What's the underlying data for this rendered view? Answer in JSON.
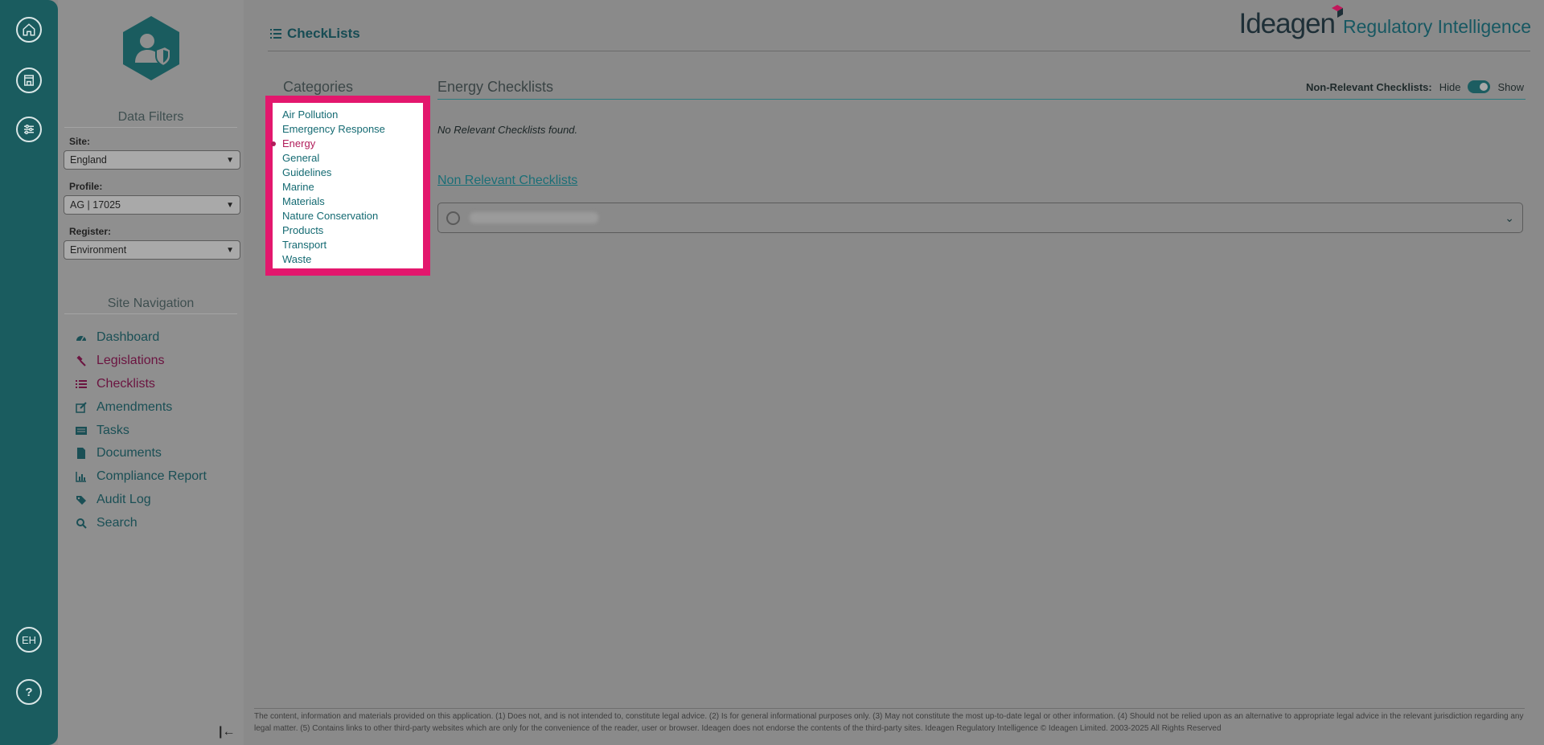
{
  "rail": {
    "items": [
      {
        "icon": "home-icon"
      },
      {
        "icon": "building-icon"
      },
      {
        "icon": "sliders-icon"
      }
    ],
    "user_initials": "EH",
    "help_label": "?"
  },
  "sidebar": {
    "data_filters_title": "Data Filters",
    "site_label": "Site:",
    "site_value": "England",
    "profile_label": "Profile:",
    "profile_value": "AG | 17025",
    "register_label": "Register:",
    "register_value": "Environment",
    "site_nav_title": "Site Navigation",
    "nav": [
      {
        "label": "Dashboard",
        "icon": "dashboard-icon"
      },
      {
        "label": "Legislations",
        "icon": "gavel-icon"
      },
      {
        "label": "Checklists",
        "icon": "list-icon",
        "active": true
      },
      {
        "label": "Amendments",
        "icon": "edit-icon"
      },
      {
        "label": "Tasks",
        "icon": "tasks-icon"
      },
      {
        "label": "Documents",
        "icon": "document-icon"
      },
      {
        "label": "Compliance Report",
        "icon": "bar-chart-icon"
      },
      {
        "label": "Audit Log",
        "icon": "tags-icon"
      },
      {
        "label": "Search",
        "icon": "search-icon"
      }
    ]
  },
  "header": {
    "title": "CheckLists",
    "brand_name": "Ideagen",
    "brand_product": "Regulatory Intelligence"
  },
  "categories": {
    "title": "Categories",
    "items": [
      "Air Pollution",
      "Emergency Response",
      "Energy",
      "General",
      "Guidelines",
      "Marine",
      "Materials",
      "Nature Conservation",
      "Products",
      "Transport",
      "Waste"
    ],
    "selected": "Energy"
  },
  "content": {
    "title": "Energy Checklists",
    "non_relevant_label": "Non-Relevant Checklists:",
    "hide_label": "Hide",
    "show_label": "Show",
    "no_found": "No Relevant Checklists found.",
    "non_relevant_link": "Non Relevant Checklists"
  },
  "footer": {
    "text": "The content, information and materials provided on this application. (1) Does not, and is not intended to, constitute legal advice. (2) Is for general informational purposes only. (3) May not constitute the most up-to-date legal or other information. (4) Should not be relied upon as an alternative to appropriate legal advice in the relevant jurisdiction regarding any legal matter. (5) Contains links to other third-party websites which are only for the convenience of the reader, user or browser. Ideagen does not endorse the contents of the third-party sites. Ideagen Regulatory Intelligence © Ideagen Limited. 2003-2025 All Rights Reserved"
  },
  "colors": {
    "rail": "#1a5c5f",
    "accent": "#e3176d",
    "link": "#146a72",
    "active": "#b11d5a"
  }
}
